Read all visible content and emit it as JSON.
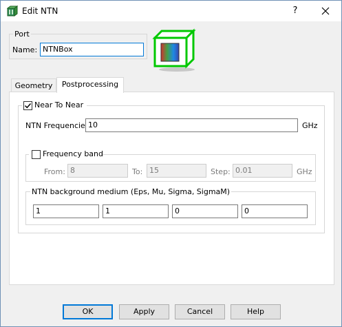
{
  "window": {
    "title": "Edit NTN",
    "help_label": "?"
  },
  "port": {
    "group_title": "Port",
    "name_label": "Name:",
    "name_value": "NTNBox"
  },
  "tabs": [
    {
      "label": "Geometry"
    },
    {
      "label": "Postprocessing"
    }
  ],
  "postprocessing": {
    "near_to_near": {
      "label": "Near To Near",
      "checked": true
    },
    "frequencies": {
      "label": "NTN Frequencies",
      "value": "10",
      "unit": "GHz"
    },
    "frequency_band": {
      "label": "Frequency band",
      "checked": false,
      "from_label": "From:",
      "from_value": "8",
      "to_label": "To:",
      "to_value": "15",
      "step_label": "Step:",
      "step_value": "0.01",
      "unit": "GHz"
    },
    "background_medium": {
      "label": "NTN background medium (Eps, Mu, Sigma, SigmaM)",
      "values": [
        "1",
        "1",
        "0",
        "0"
      ]
    }
  },
  "buttons": {
    "ok": "OK",
    "apply": "Apply",
    "cancel": "Cancel",
    "help": "Help"
  },
  "icons": {
    "title": "ntn-app-icon",
    "preview": "ntn-box-preview-icon"
  },
  "colors": {
    "focus_border": "#0078d7",
    "cube_edge": "#00c800"
  }
}
